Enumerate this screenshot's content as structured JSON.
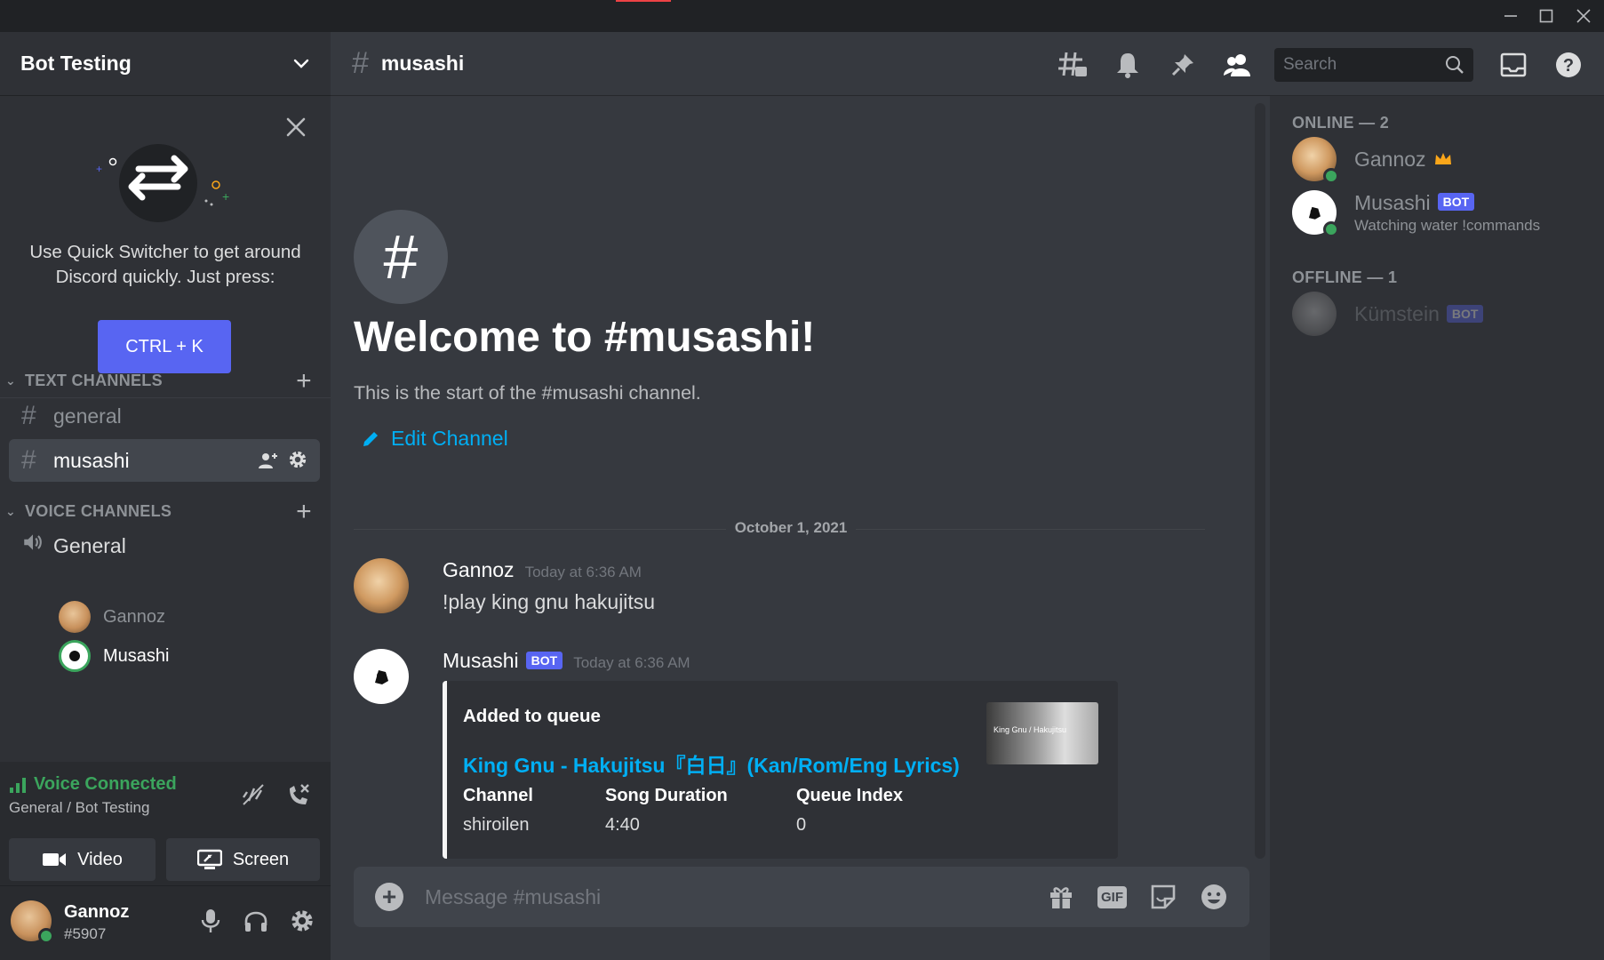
{
  "window": {
    "minimize_icon": "minimize-icon",
    "maximize_icon": "maximize-icon",
    "close_icon": "close-icon"
  },
  "guild": {
    "name": "Bot Testing"
  },
  "quick_switcher": {
    "text": "Use Quick Switcher to get around Discord quickly. Just press:",
    "shortcut": "CTRL + K"
  },
  "categories": {
    "text": "TEXT CHANNELS",
    "voice": "VOICE CHANNELS"
  },
  "text_channels": [
    {
      "name": "general",
      "active": false
    },
    {
      "name": "musashi",
      "active": true
    }
  ],
  "voice_channel": {
    "name": "General",
    "users": [
      "Gannoz",
      "Musashi"
    ]
  },
  "voice_panel": {
    "status": "Voice Connected",
    "location": "General / Bot Testing",
    "video_label": "Video",
    "screen_label": "Screen"
  },
  "user": {
    "name": "Gannoz",
    "tag": "#5907"
  },
  "header": {
    "channel": "musashi",
    "search_placeholder": "Search"
  },
  "welcome": {
    "title": "Welcome to #musashi!",
    "subtitle": "This is the start of the #musashi channel.",
    "edit_label": "Edit Channel"
  },
  "date_divider": "October 1, 2021",
  "messages": [
    {
      "author": "Gannoz",
      "time": "Today at 6:36 AM",
      "content": "!play king gnu hakujitsu"
    },
    {
      "author": "Musashi",
      "bot_tag": "BOT",
      "time": "Today at 6:36 AM",
      "embed": {
        "title": "Added to queue",
        "link": "King Gnu - Hakujitsu『白日』(Kan/Rom/Eng Lyrics)",
        "thumbnail_text": "King Gnu / Hakujitsu",
        "fields": [
          {
            "name": "Channel",
            "value": "shiroilen"
          },
          {
            "name": "Song Duration",
            "value": "4:40"
          },
          {
            "name": "Queue Index",
            "value": "0"
          }
        ]
      }
    }
  ],
  "composer": {
    "placeholder": "Message #musashi",
    "gif_label": "GIF"
  },
  "members": {
    "online_label": "ONLINE — 2",
    "offline_label": "OFFLINE — 1",
    "online": [
      {
        "name": "Gannoz",
        "status": ""
      },
      {
        "name": "Musashi",
        "bot_tag": "BOT",
        "status": "Watching water !commands"
      }
    ],
    "offline": [
      {
        "name": "Kümstein",
        "bot_tag": "BOT"
      }
    ]
  },
  "colors": {
    "accent": "#5865f2",
    "link": "#00aff4",
    "online": "#3ba55d",
    "background": "#36393f",
    "sidebar": "#2f3136"
  }
}
